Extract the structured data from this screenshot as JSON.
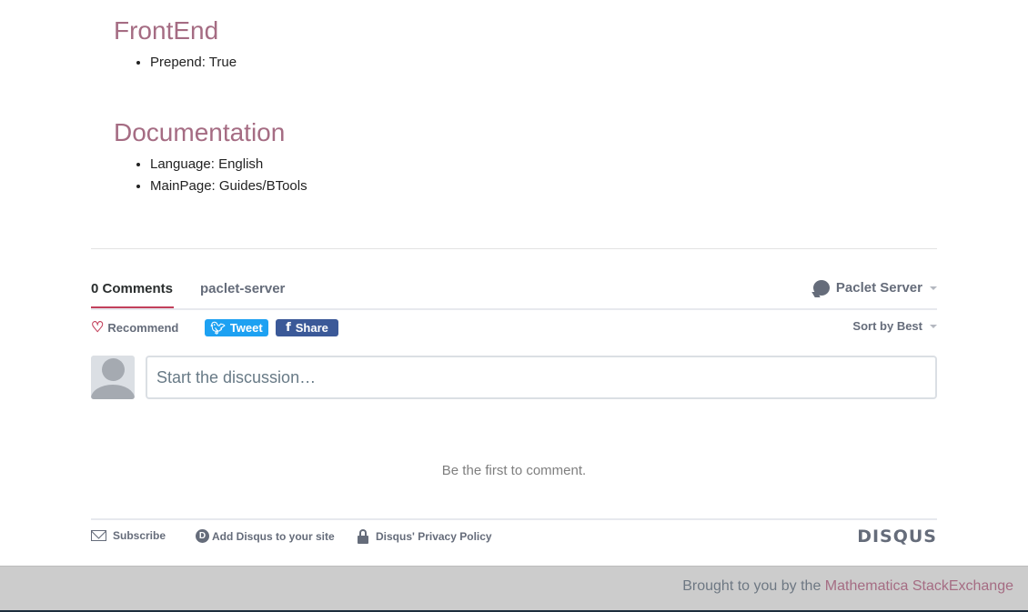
{
  "sections": [
    {
      "title": "FrontEnd",
      "items": [
        "Prepend: True"
      ]
    },
    {
      "title": "Documentation",
      "items": [
        "Language: English",
        "MainPage: Guides/BTools"
      ]
    }
  ],
  "disqus": {
    "comments_tab": "0 Comments",
    "forum_tab": "paclet-server",
    "user_menu": "Paclet Server",
    "recommend": "Recommend",
    "tweet": "Tweet",
    "share": "Share",
    "sort": "Sort by Best",
    "composer_placeholder": "Start the discussion…",
    "empty_message": "Be the first to comment.",
    "footer": {
      "subscribe": "Subscribe",
      "add_disqus": "Add Disqus to your site",
      "privacy": "Disqus' Privacy Policy",
      "logo": "DISQUS"
    },
    "colors": {
      "accent": "#c2405b",
      "twitter": "#1da1f2",
      "facebook": "#3b5998",
      "text": "#656c7a"
    }
  },
  "bottom_bar": {
    "prefix": "Brought to you by the ",
    "link": "Mathematica StackExchange"
  },
  "colors": {
    "heading": "#a56c83"
  }
}
